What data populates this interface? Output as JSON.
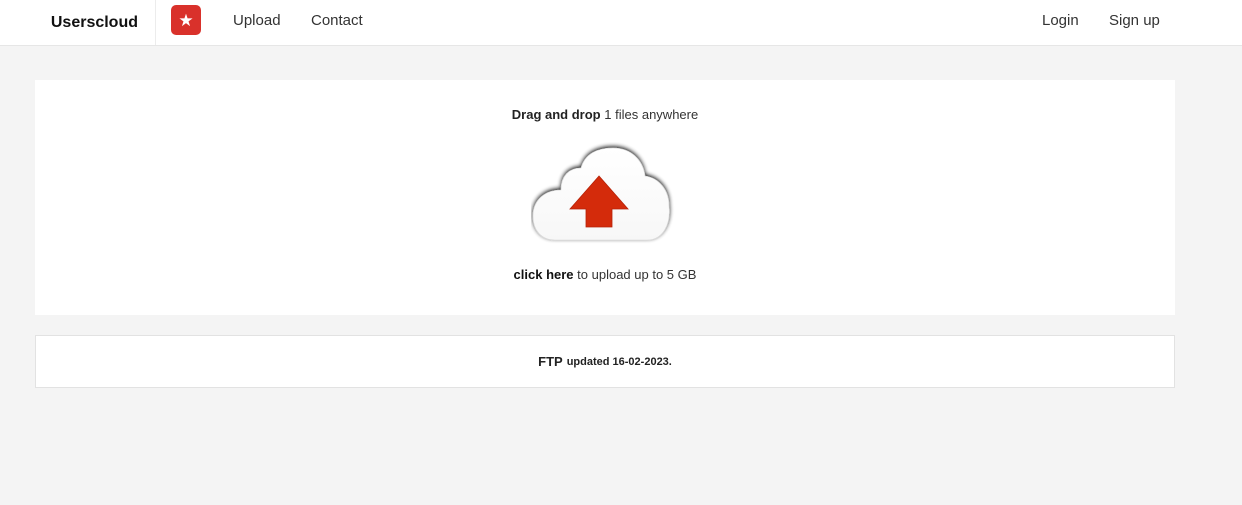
{
  "header": {
    "brand": "Userscloud",
    "badge_icon": "star-icon",
    "badge_color": "#d9312b",
    "nav": {
      "upload": "Upload",
      "contact": "Contact",
      "login": "Login",
      "signup": "Sign up"
    }
  },
  "upload": {
    "drag_bold": "Drag and drop",
    "drag_count": "1",
    "drag_rest": "files anywhere",
    "cloud_icon": "cloud-upload-icon",
    "arrow_color": "#d42b0b",
    "click_bold": "click here",
    "click_rest": "to upload up to 5 GB"
  },
  "ftp": {
    "title": "FTP",
    "note": "updated 16-02-2023."
  }
}
